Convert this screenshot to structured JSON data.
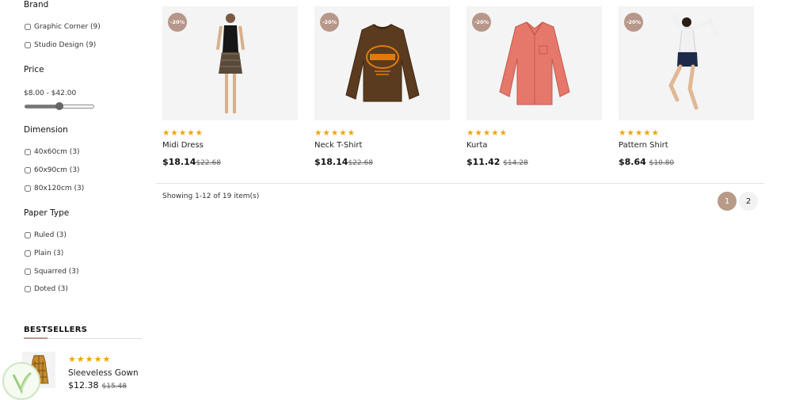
{
  "sidebar": {
    "brand": {
      "title": "Brand",
      "items": [
        {
          "label": "Graphic Corner (9)"
        },
        {
          "label": "Studio Design (9)"
        }
      ]
    },
    "price": {
      "title": "Price",
      "range": "$8.00 - $42.00",
      "slider_min_fraction": 0.0,
      "slider_max_fraction": 0.5
    },
    "dimension": {
      "title": "Dimension",
      "items": [
        {
          "label": "40x60cm (3)"
        },
        {
          "label": "60x90cm (3)"
        },
        {
          "label": "80x120cm (3)"
        }
      ]
    },
    "paper_type": {
      "title": "Paper Type",
      "items": [
        {
          "label": "Ruled (3)"
        },
        {
          "label": "Plain (3)"
        },
        {
          "label": "Squarred (3)"
        },
        {
          "label": "Doted (3)"
        }
      ]
    },
    "bestsellers": {
      "title": "BESTSELLERS",
      "item": {
        "stars": "★★★★★",
        "name": "Sleeveless Gown",
        "price": "$12.38",
        "old_price": "$15.48"
      }
    }
  },
  "products": [
    {
      "badge": "-20%",
      "stars": "★★★★★",
      "name": "Midi Dress",
      "price": "$18.14",
      "old_price": "$22.68"
    },
    {
      "badge": "-20%",
      "stars": "★★★★★",
      "name": "Neck T-Shirt",
      "price": "$18.14",
      "old_price": "$22.68"
    },
    {
      "badge": "-20%",
      "stars": "★★★★★",
      "name": "Kurta",
      "price": "$11.42",
      "old_price": "$14.28"
    },
    {
      "badge": "-20%",
      "stars": "★★★★★",
      "name": "Pattern Shirt",
      "price": "$8.64",
      "old_price": "$10.80"
    }
  ],
  "pagination": {
    "showing": "Showing 1-12 of 19 item(s)",
    "pages": [
      "1",
      "2"
    ]
  },
  "colors": {
    "accent": "#b89a88",
    "stars": "#f5a300"
  }
}
